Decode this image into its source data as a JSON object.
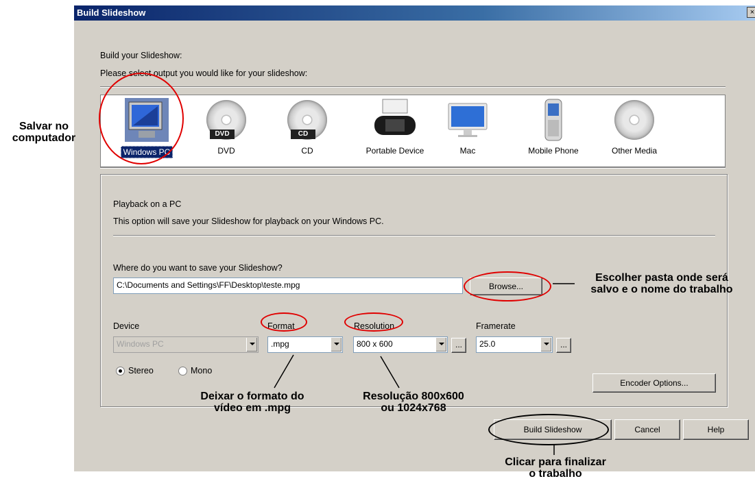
{
  "dialog": {
    "title": "Build Slideshow",
    "close_label": "×"
  },
  "intro": {
    "heading": "Build your Slideshow:",
    "prompt": "Please select output you would like for your slideshow:"
  },
  "outputs": [
    {
      "label": "Windows PC",
      "icon": "windows-pc-icon",
      "selected": true
    },
    {
      "label": "DVD",
      "icon": "dvd-disc-icon",
      "badge": "DVD"
    },
    {
      "label": "CD",
      "icon": "cd-disc-icon",
      "badge": "CD"
    },
    {
      "label": "Portable Device",
      "icon": "psp-device-icon"
    },
    {
      "label": "Mac",
      "icon": "mac-monitor-icon"
    },
    {
      "label": "Mobile Phone",
      "icon": "mobile-phone-icon"
    },
    {
      "label": "Other Media",
      "icon": "other-media-disc-icon"
    }
  ],
  "panel": {
    "title": "Playback on a PC",
    "description": "This option will save your Slideshow for playback on your Windows PC.",
    "save_label": "Where do you want to save your Slideshow?",
    "save_path": "C:\\Documents and Settings\\FF\\Desktop\\teste.mpg",
    "browse_label": "Browse...",
    "device_label": "Device",
    "device_value": "Windows PC",
    "format_label": "Format",
    "format_value": ".mpg",
    "resolution_label": "Resolution",
    "resolution_value": "800 x 600",
    "framerate_label": "Framerate",
    "framerate_value": "25.0",
    "ellipsis": "...",
    "stereo_label": "Stereo",
    "mono_label": "Mono",
    "encoder_label": "Encoder Options..."
  },
  "buttons": {
    "build": "Build Slideshow",
    "cancel": "Cancel",
    "help": "Help"
  },
  "annotations": {
    "salvar": [
      "Salvar no",
      "computador"
    ],
    "escolher": [
      "Escolher pasta onde será",
      "salvo e o nome do trabalho"
    ],
    "deixar": [
      "Deixar o formato do",
      "vídeo em .mpg"
    ],
    "resolucao": [
      "Resolução 800x600",
      "ou 1024x768"
    ],
    "clicar": [
      "Clicar para finalizar",
      "o trabalho"
    ]
  },
  "colors": {
    "annotation_ring": "#e00000",
    "selection": "#0a246a",
    "dialog_bg": "#d4d0c8"
  }
}
